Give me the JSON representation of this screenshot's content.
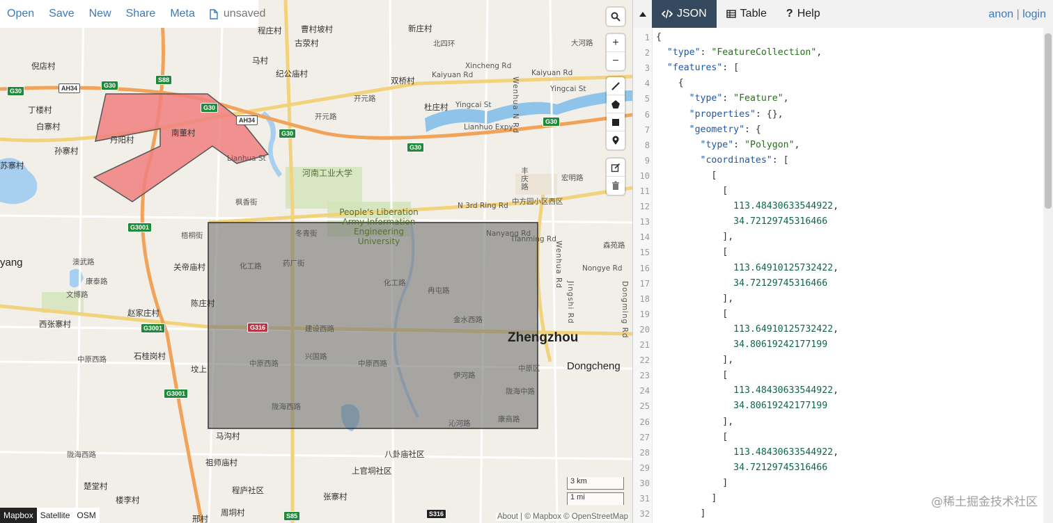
{
  "menu": {
    "items": [
      "Open",
      "Save",
      "New",
      "Share",
      "Meta"
    ],
    "file_status": "unsaved"
  },
  "map": {
    "place_labels": [
      {
        "text": "倪店村",
        "pos": "city"
      },
      {
        "text": "丁楼村"
      },
      {
        "text": "白寨村"
      },
      {
        "text": "孙寨村"
      },
      {
        "text": "苏寨村"
      },
      {
        "text": "丹阳村"
      },
      {
        "text": "南董村"
      },
      {
        "text": "程庄村"
      },
      {
        "text": "曹村坡村"
      },
      {
        "text": "新庄村"
      },
      {
        "text": "古荥村"
      },
      {
        "text": "北四环"
      },
      {
        "text": "大河路"
      },
      {
        "text": "马村"
      },
      {
        "text": "纪公庙村"
      },
      {
        "text": "双桥村"
      },
      {
        "text": "杜庄村"
      },
      {
        "text": "开元路"
      },
      {
        "text": "开元路"
      },
      {
        "text": "河南工业大学"
      },
      {
        "text": "枫香街"
      },
      {
        "text": "冬青街"
      },
      {
        "text": "梧桐街"
      },
      {
        "text": "关帝庙村"
      },
      {
        "text": "化工路"
      },
      {
        "text": "药厂街"
      },
      {
        "text": "化工路"
      },
      {
        "text": "冉屯路"
      },
      {
        "text": "澳武路"
      },
      {
        "text": "康泰路"
      },
      {
        "text": "文博路"
      },
      {
        "text": "赵家庄村"
      },
      {
        "text": "陈庄村"
      },
      {
        "text": "西张寨村"
      },
      {
        "text": "建设西路"
      },
      {
        "text": "金水西路"
      },
      {
        "text": "兴国路"
      },
      {
        "text": "中原西路"
      },
      {
        "text": "中原西路"
      },
      {
        "text": "中原西路"
      },
      {
        "text": "石桂岗村"
      },
      {
        "text": "坟上"
      },
      {
        "text": "伊河路"
      },
      {
        "text": "陇海中路"
      },
      {
        "text": "陇海西路"
      },
      {
        "text": "沁河路"
      },
      {
        "text": "康商路"
      },
      {
        "text": "马沟村"
      },
      {
        "text": "八卦庙社区"
      },
      {
        "text": "祖师庙村"
      },
      {
        "text": "上官垌社区"
      },
      {
        "text": "程庐社区"
      },
      {
        "text": "张寨村"
      },
      {
        "text": "楼李村"
      },
      {
        "text": "邢村"
      },
      {
        "text": "周垌村"
      },
      {
        "text": "楚堂村"
      },
      {
        "text": "陇海西路"
      },
      {
        "text": "中原区"
      },
      {
        "text": "中方园小区西区"
      },
      {
        "text": "宏明路"
      },
      {
        "text": "森苑路"
      },
      {
        "text": "丰庆路"
      },
      {
        "text": "Dongcheng"
      },
      {
        "text": "Zhengzhou"
      },
      {
        "text": "yang"
      }
    ],
    "road_labels": [
      "Xincheng Rd",
      "Kaiyuan Rd",
      "Kaiyuan Rd",
      "Yingcai St",
      "Yingcai St",
      "Lianhuo Expy",
      "Lianhua St",
      "N 3rd Ring Rd",
      "Nanyang Rd",
      "Tianming Rd",
      "Wenhua N Rd",
      "Wenhua Rd",
      "Nongye Rd",
      "Jingshi Rd",
      "Dongming Rd"
    ],
    "shields": [
      "AH34",
      "G30",
      "G30",
      "S88",
      "G30",
      "AH34",
      "G30",
      "G30",
      "G30",
      "G3001",
      "G3001",
      "G3001",
      "G316",
      "S85",
      "S316"
    ],
    "poi_label": "People's Liberation Army Information Engineering University",
    "scale": {
      "top": "3 km",
      "bottom": "1 mi"
    },
    "layers": [
      "Mapbox",
      "Satellite",
      "OSM"
    ],
    "active_layer": "Mapbox",
    "attribution": "About | © Mapbox © OpenStreetMap",
    "controls": {
      "search": "search-icon",
      "zoom_in": "+",
      "zoom_out": "−",
      "draw_tools": [
        "line-icon",
        "polygon-icon",
        "rectangle-icon",
        "marker-icon"
      ],
      "edit_tools": [
        "edit-icon",
        "trash-icon"
      ]
    }
  },
  "editor": {
    "tabs": [
      {
        "label": "JSON",
        "icon": "code-icon",
        "active": true
      },
      {
        "label": "Table",
        "icon": "table-icon",
        "active": false
      },
      {
        "label": "Help",
        "icon": "help-icon",
        "active": false
      }
    ],
    "auth": {
      "anon": "anon",
      "sep": "|",
      "login": "login"
    },
    "lines": [
      "{",
      "  \"type\": \"FeatureCollection\",",
      "  \"features\": [",
      "    {",
      "      \"type\": \"Feature\",",
      "      \"properties\": {},",
      "      \"geometry\": {",
      "        \"type\": \"Polygon\",",
      "        \"coordinates\": [",
      "          [",
      "            [",
      "              113.48430633544922,",
      "              34.72129745316466",
      "            ],",
      "            [",
      "              113.64910125732422,",
      "              34.72129745316466",
      "            ],",
      "            [",
      "              113.64910125732422,",
      "              34.80619242177199",
      "            ],",
      "            [",
      "              113.48430633544922,",
      "              34.80619242177199",
      "            ],",
      "            [",
      "              113.48430633544922,",
      "              34.72129745316466",
      "            ]",
      "          ]",
      "        ]"
    ]
  },
  "watermark": "@稀土掘金技术社区",
  "colors": {
    "accent": "#3a7bbf",
    "tab_active": "#34495e",
    "polygon_fill": "#f08080",
    "rect_fill": "#7a7a7a"
  }
}
